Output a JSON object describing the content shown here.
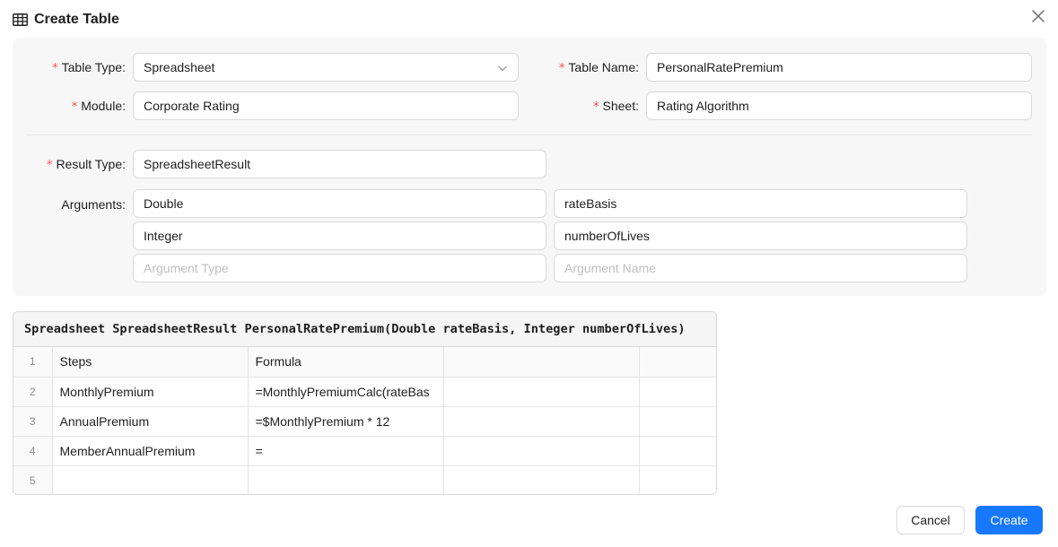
{
  "dialog": {
    "title": "Create Table",
    "title_icon": "table-icon",
    "close_icon": "close-icon"
  },
  "form": {
    "table_type": {
      "label": "Table Type:",
      "value": "Spreadsheet",
      "required": true
    },
    "table_name": {
      "label": "Table Name:",
      "value": "PersonalRatePremium",
      "required": true
    },
    "module": {
      "label": "Module:",
      "value": "Corporate Rating",
      "required": true
    },
    "sheet": {
      "label": "Sheet:",
      "value": "Rating Algorithm",
      "required": true
    },
    "result_type": {
      "label": "Result Type:",
      "value": "SpreadsheetResult",
      "required": true
    },
    "arguments": {
      "label": "Arguments:",
      "rows": [
        {
          "type": "Double",
          "name": "rateBasis"
        },
        {
          "type": "Integer",
          "name": "numberOfLives"
        },
        {
          "type": "",
          "name": ""
        }
      ],
      "type_placeholder": "Argument Type",
      "name_placeholder": "Argument Name"
    }
  },
  "preview": {
    "signature": "Spreadsheet SpreadsheetResult PersonalRatePremium(Double rateBasis, Integer numberOfLives)",
    "rows": [
      {
        "num": "1",
        "cells": [
          "Steps",
          "Formula",
          "",
          ""
        ]
      },
      {
        "num": "2",
        "cells": [
          "MonthlyPremium",
          "=MonthlyPremiumCalc(rateBas",
          "",
          ""
        ]
      },
      {
        "num": "3",
        "cells": [
          "AnnualPremium",
          "=$MonthlyPremium * 12",
          "",
          ""
        ]
      },
      {
        "num": "4",
        "cells": [
          "MemberAnnualPremium",
          "=",
          "",
          ""
        ]
      },
      {
        "num": "5",
        "cells": [
          "",
          "",
          "",
          ""
        ]
      }
    ]
  },
  "footer": {
    "cancel_label": "Cancel",
    "create_label": "Create"
  },
  "colors": {
    "primary": "#1677ff",
    "required": "#ff4d4f",
    "panel_bg": "#f7f7f7"
  }
}
